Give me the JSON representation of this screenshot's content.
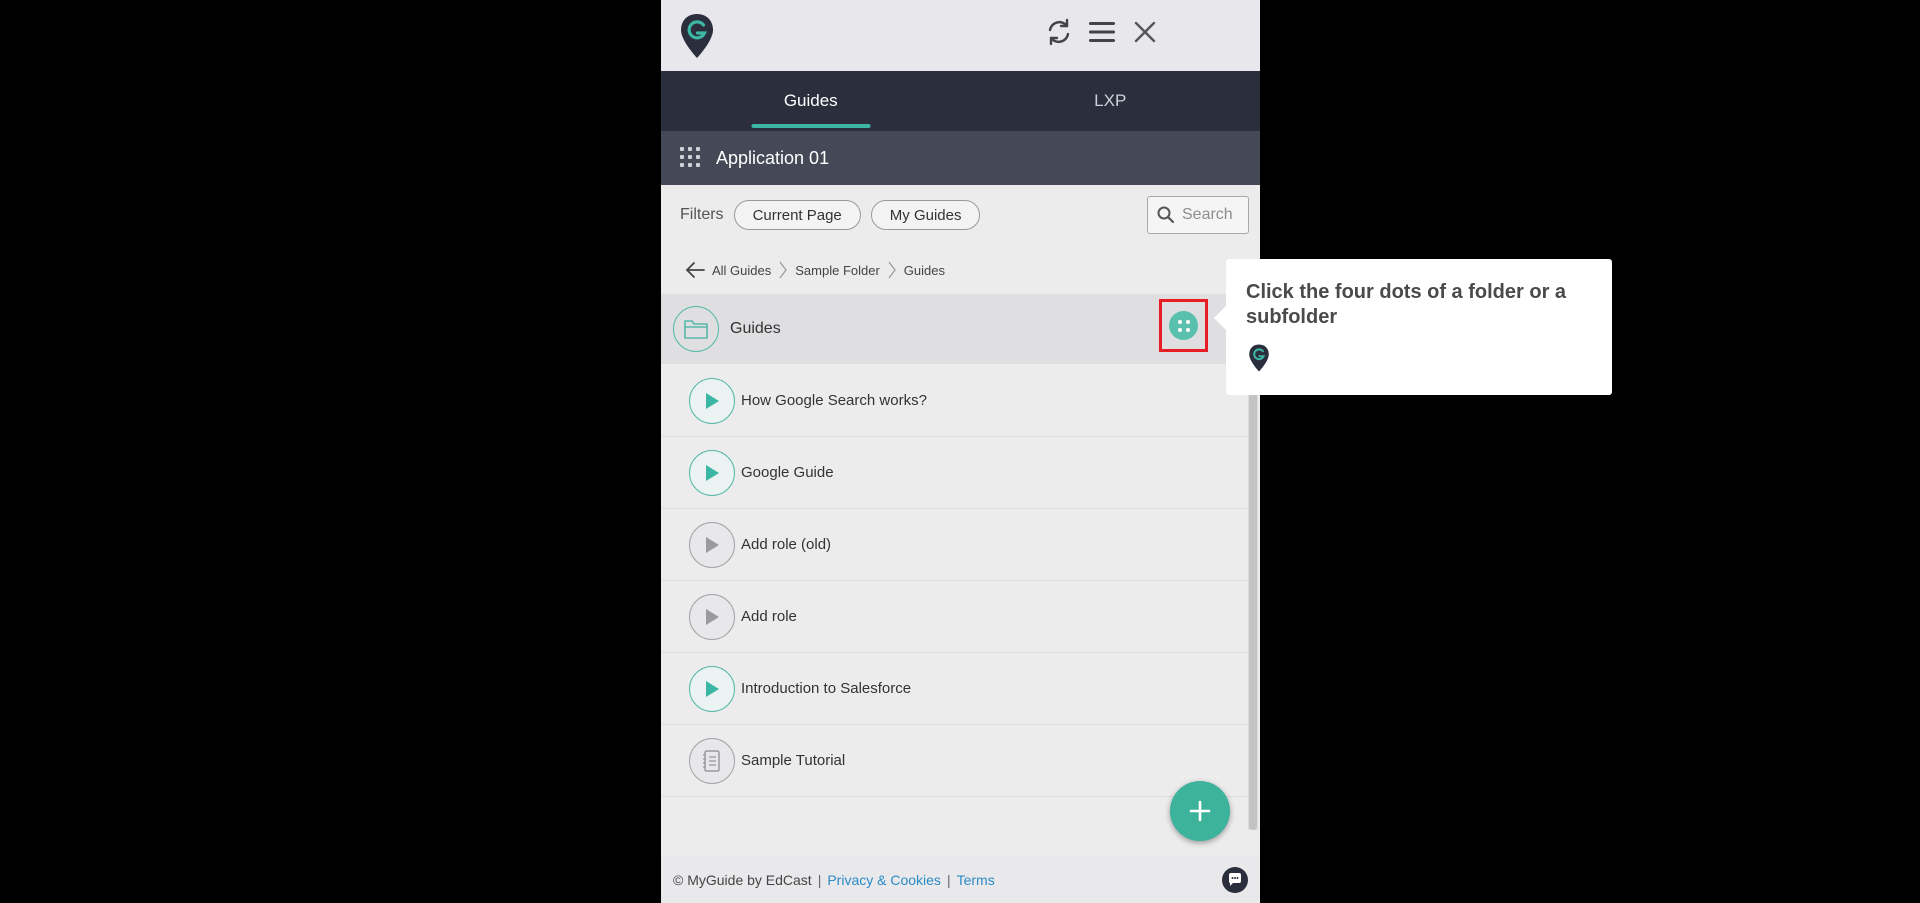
{
  "header": {
    "logo_letter": "G",
    "icons": [
      "sync-icon",
      "menu-icon",
      "close-icon"
    ]
  },
  "tabs": [
    {
      "label": "Guides",
      "active": true
    },
    {
      "label": "LXP",
      "active": false
    }
  ],
  "app": {
    "name": "Application 01"
  },
  "filters": {
    "label": "Filters",
    "chips": [
      "Current Page",
      "My Guides"
    ],
    "search_placeholder": "Search"
  },
  "breadcrumb": [
    "All Guides",
    "Sample Folder",
    "Guides"
  ],
  "folder": {
    "name": "Guides"
  },
  "guides": [
    {
      "title": "How Google Search works?",
      "icon": "play-icon",
      "state": "active"
    },
    {
      "title": "Google Guide",
      "icon": "play-icon",
      "state": "active"
    },
    {
      "title": "Add role (old)",
      "icon": "play-icon",
      "state": "inactive"
    },
    {
      "title": "Add role",
      "icon": "play-icon",
      "state": "inactive"
    },
    {
      "title": "Introduction to Salesforce",
      "icon": "play-icon",
      "state": "active"
    },
    {
      "title": "Sample Tutorial",
      "icon": "document-icon",
      "state": "inactive"
    }
  ],
  "footer": {
    "copyright": "© MyGuide by EdCast",
    "separator": "|",
    "privacy": "Privacy & Cookies",
    "terms": "Terms"
  },
  "tooltip": {
    "text": "Click the four dots of a folder or a subfolder"
  },
  "colors": {
    "accent": "#3bb7a3",
    "tab_bar": "#2b2f3d",
    "app_bar": "#454957",
    "highlight": "#e81e25",
    "link": "#2a8bc6"
  }
}
